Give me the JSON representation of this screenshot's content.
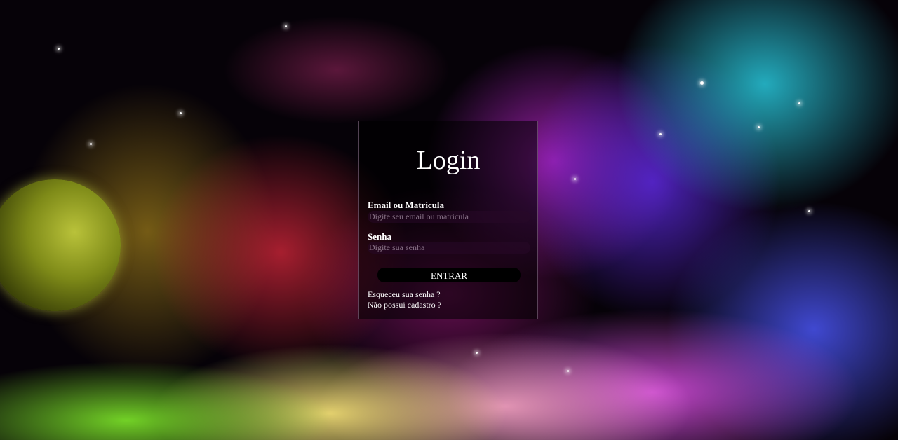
{
  "login": {
    "title": "Login",
    "email": {
      "label": "Email ou Matricula",
      "placeholder": "Digite seu email ou matricula"
    },
    "password": {
      "label": "Senha",
      "placeholder": "Digite sua senha"
    },
    "submit_label": "ENTRAR",
    "forgot_password_link": "Esqueceu sua senha ?",
    "register_link": "Não possui cadastro ?"
  },
  "colors": {
    "panel_background": "rgba(0,0,0,0.55)",
    "button_background": "#000000",
    "text": "#ffffff"
  }
}
